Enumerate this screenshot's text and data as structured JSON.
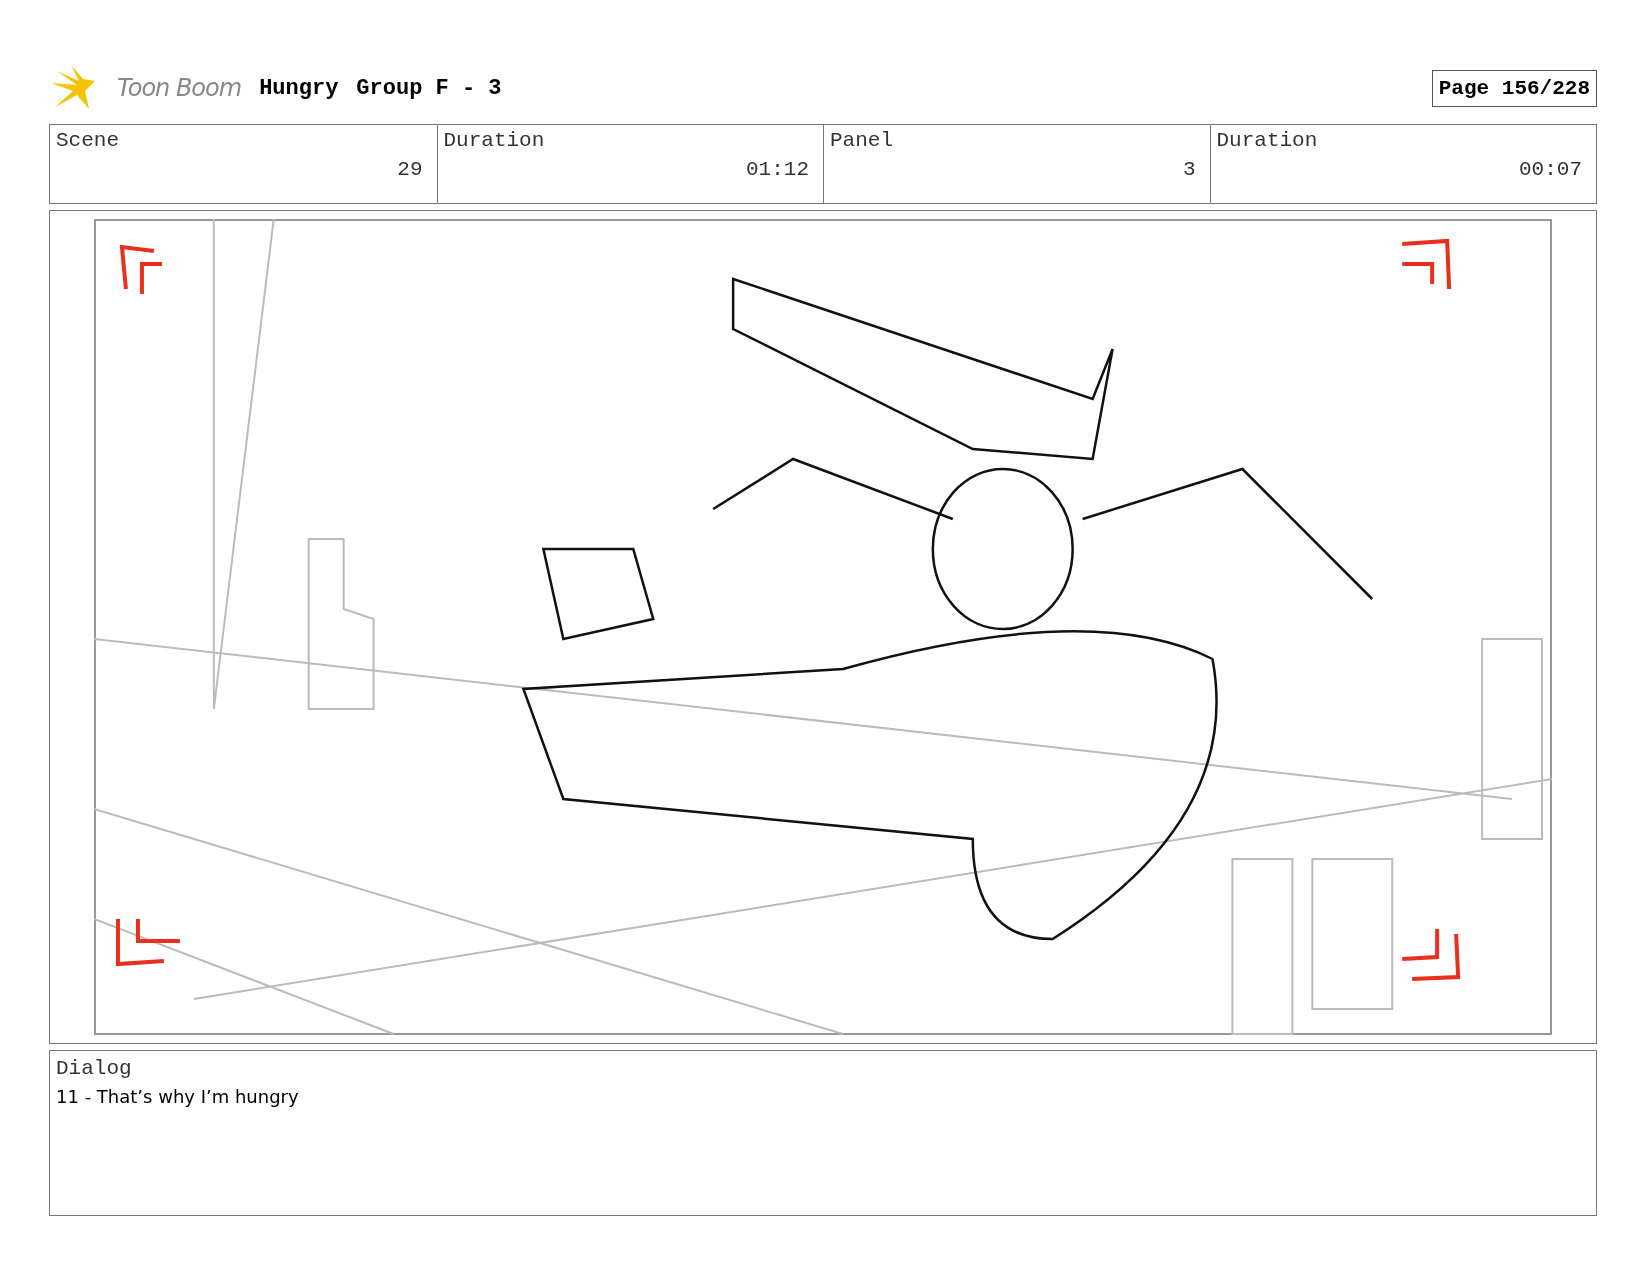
{
  "header": {
    "brand": "Toon Boom",
    "project": "Hungry",
    "sequence": "Group F - 3",
    "page": "Page 156/228"
  },
  "info": [
    {
      "label": "Scene",
      "value": "29"
    },
    {
      "label": "Duration",
      "value": "01:12"
    },
    {
      "label": "Panel",
      "value": "3"
    },
    {
      "label": "Duration",
      "value": "00:07"
    }
  ],
  "dialog": {
    "label": "Dialog",
    "text": "11 - That’s why I’m hungry"
  }
}
